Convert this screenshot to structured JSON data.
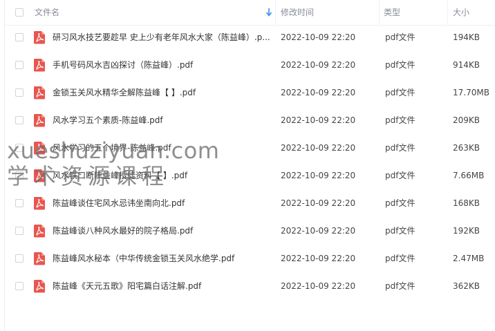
{
  "columns": {
    "name": "文件名",
    "modified": "修改时间",
    "type": "类型",
    "size": "大小"
  },
  "files": [
    {
      "name": "研习风水技艺要趁早 史上少有老年风水大家（陈益峰）.p...",
      "modified": "2022-10-09 22:20",
      "type": "pdf文件",
      "size": "194KB"
    },
    {
      "name": "手机号码风水吉凶探讨（陈益峰）.pdf",
      "modified": "2022-10-09 22:20",
      "type": "pdf文件",
      "size": "914KB"
    },
    {
      "name": "金锁玉关风水精华全解陈益峰【 】.pdf",
      "modified": "2022-10-09 22:20",
      "type": "pdf文件",
      "size": "17.70MB"
    },
    {
      "name": "风水学习五个素质-陈益峰.pdf",
      "modified": "2022-10-09 22:20",
      "type": "pdf文件",
      "size": "209KB"
    },
    {
      "name": "风水学习的五个境界-陈益峰.pdf",
      "modified": "2022-10-09 22:20",
      "type": "pdf文件",
      "size": "263KB"
    },
    {
      "name": "风水铁口断陈益峰授徒资料【 】.pdf",
      "modified": "2022-10-09 22:20",
      "type": "pdf文件",
      "size": "7.66MB"
    },
    {
      "name": "陈益峰谈住宅风水忌讳坐南向北.pdf",
      "modified": "2022-10-09 22:20",
      "type": "pdf文件",
      "size": "168KB"
    },
    {
      "name": "陈益峰谈八种风水最好的院子格局.pdf",
      "modified": "2022-10-09 22:20",
      "type": "pdf文件",
      "size": "192KB"
    },
    {
      "name": "陈益峰风水秘本（中华传统金锁玉关风水绝学.pdf",
      "modified": "2022-10-09 22:20",
      "type": "pdf文件",
      "size": "2.47MB"
    },
    {
      "name": "陈益峰《天元五歌》阳宅篇白话注解.pdf",
      "modified": "2022-10-09 22:20",
      "type": "pdf文件",
      "size": "362KB"
    }
  ],
  "watermark": {
    "line1": "xueshuziyuan.com",
    "line2": "学术资源课程"
  },
  "icons": {
    "file": "pdf-file-icon",
    "sort": "sort-down-arrow-icon"
  },
  "colors": {
    "pdf_icon": "#e8564f",
    "sort_arrow": "#3b8cf0",
    "header_text": "#888d99"
  }
}
